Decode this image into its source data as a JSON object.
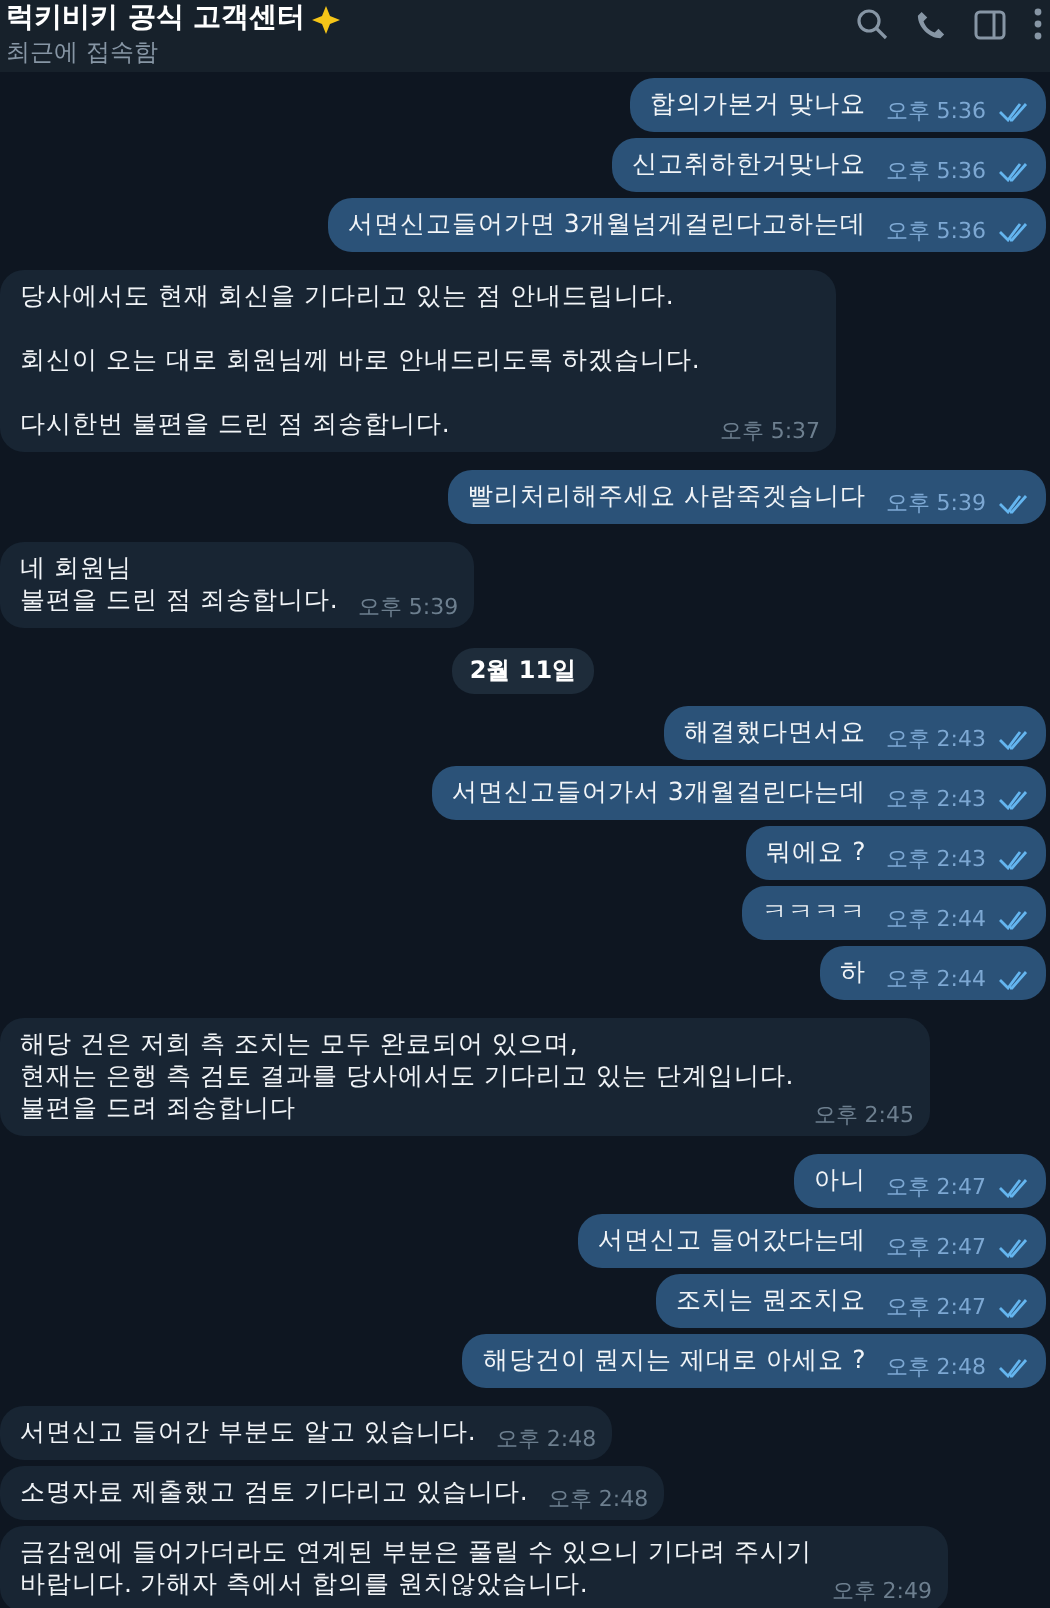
{
  "header": {
    "title": "럭키비키 공식 고객센터",
    "subtitle": "최근에 접속함"
  },
  "messages": [
    {
      "kind": "outgoing",
      "text": "합의가본거 맞나요",
      "time": "오후 5:36",
      "read": true
    },
    {
      "kind": "outgoing",
      "text": "신고취하한거맞나요",
      "time": "오후 5:36",
      "read": true
    },
    {
      "kind": "outgoing",
      "text": "서면신고들어가면 3개월넘게걸린다고하는데",
      "time": "오후 5:36",
      "read": true
    },
    {
      "kind": "incoming",
      "text": "당사에서도 현재 회신을 기다리고 있는 점 안내드립니다.\n\n회신이 오는 대로 회원님께 바로 안내드리도록 하겠습니다.\n\n다시한번 불편을 드린 점 죄송합니다.",
      "time": "오후 5:37"
    },
    {
      "kind": "outgoing",
      "text": "빨리처리해주세요 사람죽겟습니다",
      "time": "오후 5:39",
      "read": true
    },
    {
      "kind": "incoming",
      "text": "네 회원님\n불편을 드린 점 죄송합니다.",
      "time": "오후 5:39"
    },
    {
      "kind": "date",
      "text": "2월 11일"
    },
    {
      "kind": "outgoing",
      "text": "해결했다면서요",
      "time": "오후 2:43",
      "read": true
    },
    {
      "kind": "outgoing",
      "text": "서면신고들어가서 3개월걸린다는데",
      "time": "오후 2:43",
      "read": true
    },
    {
      "kind": "outgoing",
      "text": "뭐에요 ?",
      "time": "오후 2:43",
      "read": true
    },
    {
      "kind": "outgoing",
      "text": "ㅋㅋㅋㅋ",
      "time": "오후 2:44",
      "read": true
    },
    {
      "kind": "outgoing",
      "text": "하",
      "time": "오후 2:44",
      "read": true
    },
    {
      "kind": "incoming",
      "text": "해당 건은 저희 측 조치는 모두 완료되어 있으며,\n현재는 은행 측 검토 결과를 당사에서도 기다리고 있는 단계입니다.\n불편을 드려 죄송합니다",
      "time": "오후 2:45"
    },
    {
      "kind": "outgoing",
      "text": "아니",
      "time": "오후 2:47",
      "read": true
    },
    {
      "kind": "outgoing",
      "text": "서면신고 들어갔다는데",
      "time": "오후 2:47",
      "read": true
    },
    {
      "kind": "outgoing",
      "text": "조치는 뭔조치요",
      "time": "오후 2:47",
      "read": true
    },
    {
      "kind": "outgoing",
      "text": "해당건이 뭔지는 제대로 아세요 ?",
      "time": "오후 2:48",
      "read": true
    },
    {
      "kind": "incoming",
      "text": "서면신고 들어간 부분도 알고 있습니다.",
      "time": "오후 2:48"
    },
    {
      "kind": "incoming",
      "text": "소명자료 제출했고 검토 기다리고 있습니다.",
      "time": "오후 2:48"
    },
    {
      "kind": "incoming",
      "text": "금감원에 들어가더라도 연계된 부분은 풀릴 수 있으니 기다려 주시기\n바랍니다. 가해자 측에서 합의를 원치않았습니다.",
      "time": "오후 2:49"
    }
  ]
}
